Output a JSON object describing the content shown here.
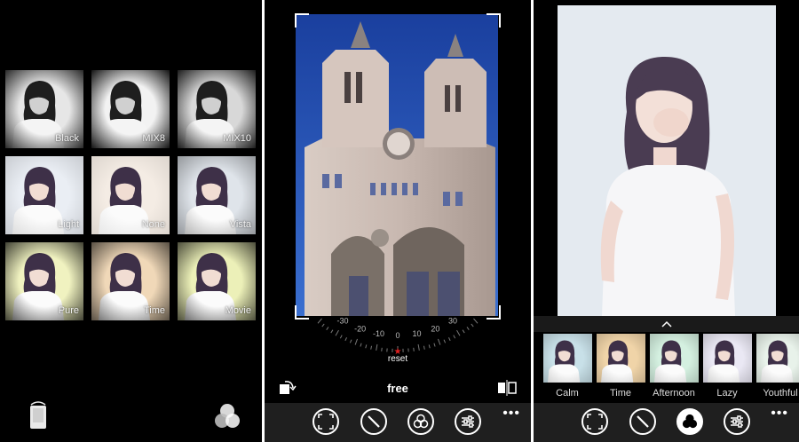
{
  "filters_panel": {
    "filters": [
      {
        "label": "Black",
        "bg": "#e6e6e6",
        "vignette": 0.85,
        "tint": "#ffffff",
        "gray": true
      },
      {
        "label": "MIX8",
        "bg": "#f2f2f2",
        "vignette": 0.95,
        "tint": "#ffffff",
        "gray": true
      },
      {
        "label": "MIX10",
        "bg": "#d8d8d8",
        "vignette": 0.9,
        "tint": "#ffffff",
        "gray": true
      },
      {
        "label": "Light",
        "bg": "#eaeef4",
        "vignette": 0.15,
        "tint": "#e9eef7",
        "gray": false
      },
      {
        "label": "None",
        "bg": "#f4ece4",
        "vignette": 0.1,
        "tint": "#f6ede2",
        "gray": false
      },
      {
        "label": "Vista",
        "bg": "#dfe4ea",
        "vignette": 0.35,
        "tint": "#dde6ee",
        "gray": false
      },
      {
        "label": "Pure",
        "bg": "#f0f2c0",
        "vignette": 0.75,
        "tint": "#eef0b0",
        "gray": false
      },
      {
        "label": "Time",
        "bg": "#f0d8b8",
        "vignette": 0.65,
        "tint": "#f2d4a8",
        "gray": false
      },
      {
        "label": "Movie",
        "bg": "#ecf0b8",
        "vignette": 0.7,
        "tint": "#eef2b4",
        "gray": false
      }
    ],
    "icons": [
      "phone-rotate-icon",
      "color-circles-icon"
    ]
  },
  "crop_panel": {
    "dial_ticks": [
      "-30",
      "-20",
      "-10",
      "0",
      "10",
      "20",
      "30"
    ],
    "reset_label": "reset",
    "aspect_label": "free",
    "icons": [
      "rotate-icon",
      "flip-icon"
    ],
    "appbar_icons": [
      "crop-icon",
      "edit-icon",
      "filters-icon",
      "adjust-icon"
    ],
    "more_label": "•••",
    "accent_color": "#e02020"
  },
  "portrait_panel": {
    "chevron": "^",
    "filters": [
      {
        "label": "Calm",
        "tint": "#c8e0e8"
      },
      {
        "label": "Time",
        "tint": "#f0d4a8"
      },
      {
        "label": "Afternoon",
        "tint": "#d4f0e0"
      },
      {
        "label": "Lazy",
        "tint": "#eae8f4"
      },
      {
        "label": "Youthful",
        "tint": "#e8f2ea"
      }
    ],
    "appbar_icons": [
      "crop-icon",
      "edit-icon",
      "filters-icon",
      "adjust-icon"
    ],
    "active_icon": "filters-icon",
    "more_label": "•••"
  }
}
